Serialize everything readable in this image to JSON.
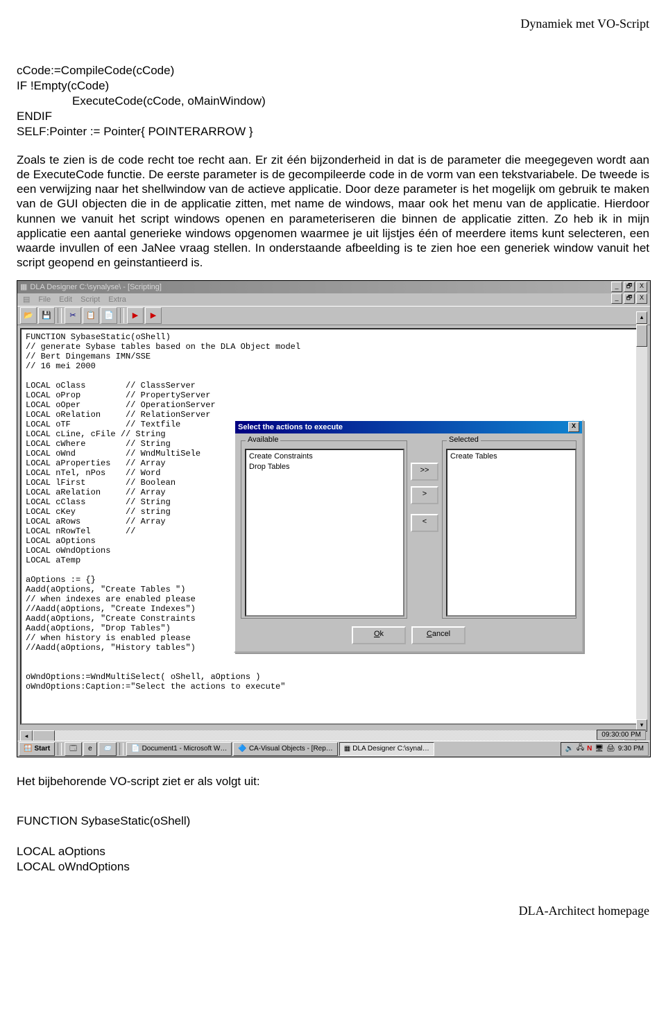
{
  "header": "Dynamiek met VO-Script",
  "codeblock": {
    "l1": "cCode:=CompileCode(cCode)",
    "l2": "IF !Empty(cCode)",
    "l3": "ExecuteCode(cCode, oMainWindow)",
    "l4": "ENDIF",
    "l5": "SELF:Pointer := Pointer{ POINTERARROW }"
  },
  "para1": "Zoals te zien is de code recht toe recht aan. Er zit één bijzonderheid in dat is de parameter die meegegeven wordt aan de ExecuteCode functie. De eerste parameter is de gecompileerde code in de vorm van een tekstvariabele. De tweede is een verwijzing naar het shellwindow van de actieve applicatie. Door deze parameter is het mogelijk om gebruik te maken van de GUI objecten die in de applicatie zitten, met name de windows, maar ook het menu van de applicatie. Hierdoor kunnen we vanuit het script windows openen en parameteriseren die binnen de applicatie zitten. Zo heb ik in mijn applicatie een aantal generieke windows opgenomen waarmee je uit lijstjes één of meerdere items kunt selecteren, een waarde invullen of een JaNee vraag stellen. In onderstaande afbeelding is te zien hoe een generiek window vanuit het script geopend en geinstantieerd is.",
  "screenshot": {
    "title": "DLA Designer C:\\synalyse\\ - [Scripting]",
    "menu": [
      "File",
      "Edit",
      "Script",
      "Extra"
    ],
    "code": "FUNCTION SybaseStatic(oShell)\n// generate Sybase tables based on the DLA Object model\n// Bert Dingemans IMN/SSE\n// 16 mei 2000\n\nLOCAL oClass        // ClassServer\nLOCAL oProp         // PropertyServer\nLOCAL oOper         // OperationServer\nLOCAL oRelation     // RelationServer\nLOCAL oTF           // Textfile\nLOCAL cLine, cFile // String\nLOCAL cWhere        // String\nLOCAL oWnd          // WndMultiSele\nLOCAL aProperties   // Array\nLOCAL nTel, nPos    // Word\nLOCAL lFirst        // Boolean\nLOCAL aRelation     // Array\nLOCAL cClass        // String\nLOCAL cKey          // string\nLOCAL aRows         // Array\nLOCAL nRowTel       //\nLOCAL aOptions\nLOCAL oWndOptions\nLOCAL aTemp\n\naOptions := {}\nAadd(aOptions, \"Create Tables \")\n// when indexes are enabled please\n//Aadd(aOptions, \"Create Indexes\")\nAadd(aOptions, \"Create Constraints\nAadd(aOptions, \"Drop Tables\")\n// when history is enabled please\n//Aadd(aOptions, \"History tables\")\n\n\noWndOptions:=WndMultiSelect( oShell, aOptions )\noWndOptions:Caption:=\"Select the actions to execute\"",
    "dialog_title": "Select the actions to execute",
    "available_label": "Available",
    "selected_label": "Selected",
    "available_items": [
      "Create Constraints",
      "Drop Tables"
    ],
    "selected_items": [
      "Create Tables"
    ],
    "btn_all_right": ">>",
    "btn_right": ">",
    "btn_left": "<",
    "ok": "Ok",
    "cancel": "Cancel",
    "close_x": "X",
    "time_status": "09:30:00 PM",
    "taskbar": {
      "start": "Start",
      "t1": "Document1 - Microsoft W…",
      "t2": "CA-Visual Objects - [Rep…",
      "t3": "DLA Designer C:\\synal…",
      "tray_time": "9:30 PM"
    }
  },
  "para2": "Het bijbehorende VO-script ziet er als volgt uit:",
  "codeblock2": {
    "l1": "FUNCTION SybaseStatic(oShell)",
    "l2": "LOCAL aOptions",
    "l3": "LOCAL oWndOptions"
  },
  "footer": "DLA-Architect homepage"
}
